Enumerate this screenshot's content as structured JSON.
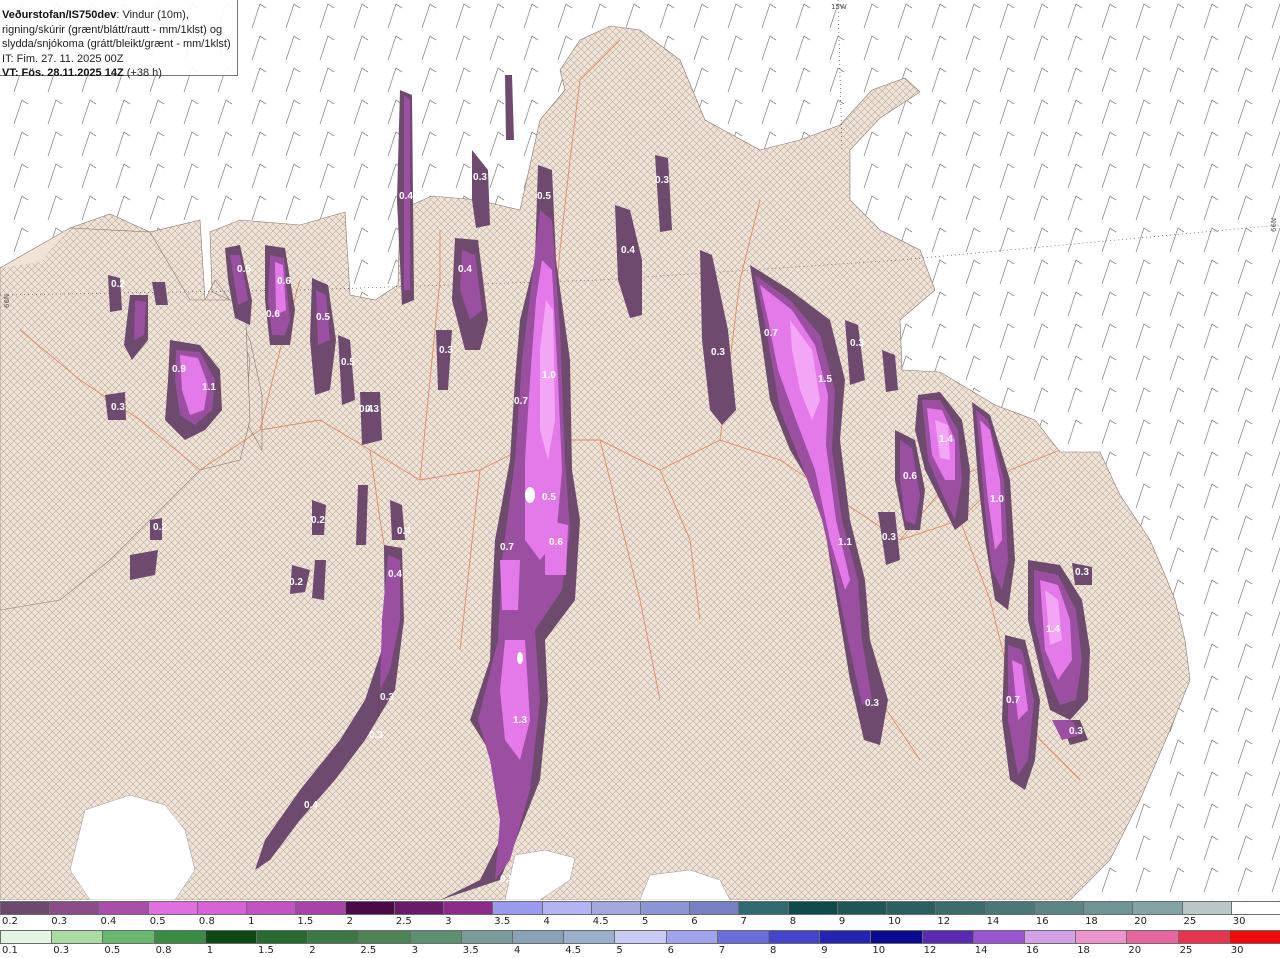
{
  "header": {
    "product": "Veðurstofan/IS750dev",
    "desc1": ": Vindur (10m),",
    "desc2": "rigning/skúrir (grænt/blátt/rautt - mm/1klst) og",
    "desc3": "slydda/snjókoma (grátt/bleikt/grænt - mm/1klst)",
    "it": "IT: Fim. 27. 11. 2025 00Z",
    "vt_bold": "VT: Fös. 28.11.2025 14Z",
    "vt_lead": " (+38 h)"
  },
  "coord_labels": {
    "top": "15W",
    "right": "66N",
    "left": "66N"
  },
  "precip_labels": [
    {
      "t": "0.4"
    },
    {
      "t": "0.4"
    },
    {
      "t": "0.3"
    },
    {
      "t": "0.3"
    },
    {
      "t": "0.5"
    },
    {
      "t": "0.6"
    },
    {
      "t": "0.6"
    },
    {
      "t": "0.5"
    },
    {
      "t": "0.5"
    },
    {
      "t": "0.4"
    },
    {
      "t": "0.3"
    },
    {
      "t": "1.0"
    },
    {
      "t": "0.7"
    },
    {
      "t": "0.5"
    },
    {
      "t": "0.7"
    },
    {
      "t": "0.6"
    },
    {
      "t": "0.9"
    },
    {
      "t": "1.1"
    },
    {
      "t": "0.3"
    },
    {
      "t": "0.2"
    },
    {
      "t": "0.2"
    },
    {
      "t": "0.4"
    },
    {
      "t": "0.2"
    },
    {
      "t": "0.2"
    },
    {
      "t": "0.4"
    },
    {
      "t": "0.3"
    },
    {
      "t": "0.3"
    },
    {
      "t": "0.4"
    },
    {
      "t": "1.3"
    },
    {
      "t": "0.5"
    },
    {
      "t": "0.7"
    },
    {
      "t": "1.5"
    },
    {
      "t": "0.3"
    },
    {
      "t": "0.4"
    },
    {
      "t": "1.4"
    },
    {
      "t": "0.6"
    },
    {
      "t": "1.0"
    },
    {
      "t": "1.1"
    },
    {
      "t": "0.3"
    },
    {
      "t": "0.3"
    },
    {
      "t": "0.3"
    },
    {
      "t": "1.4"
    },
    {
      "t": "0.7"
    },
    {
      "t": "0.3"
    },
    {
      "t": "0.3"
    },
    {
      "t": "0.3"
    },
    {
      "t": "0.5"
    }
  ],
  "legend_snow": [
    {
      "label": "0.2",
      "color": "#6b4a6e"
    },
    {
      "label": "0.3",
      "color": "#8a4d8a"
    },
    {
      "label": "0.4",
      "color": "#a94fa9"
    },
    {
      "label": "0.5",
      "color": "#e070e0"
    },
    {
      "label": "0.8",
      "color": "#d862d8"
    },
    {
      "label": "1",
      "color": "#c253c2"
    },
    {
      "label": "1.5",
      "color": "#a843a8"
    },
    {
      "label": "2",
      "color": "#4a0a4a"
    },
    {
      "label": "2.5",
      "color": "#6a1a6a"
    },
    {
      "label": "3",
      "color": "#8a2a8a"
    },
    {
      "label": "3.5",
      "color": "#9a9aee"
    },
    {
      "label": "4",
      "color": "#b4b4f4"
    },
    {
      "label": "4.5",
      "color": "#a3a9e0"
    },
    {
      "label": "5",
      "color": "#8c96d4"
    },
    {
      "label": "6",
      "color": "#7680c2"
    },
    {
      "label": "7",
      "color": "#2f6a6e"
    },
    {
      "label": "8",
      "color": "#0e4a4a"
    },
    {
      "label": "9",
      "color": "#1f5656"
    },
    {
      "label": "10",
      "color": "#2a6060"
    },
    {
      "label": "12",
      "color": "#3a6c6c"
    },
    {
      "label": "14",
      "color": "#4a7878"
    },
    {
      "label": "16",
      "color": "#5c8686"
    },
    {
      "label": "18",
      "color": "#6e9494"
    },
    {
      "label": "20",
      "color": "#84a4a4"
    },
    {
      "label": "25",
      "color": "#b8c8c8"
    },
    {
      "label": "30",
      "color": "#ffffff"
    }
  ],
  "legend_rain": [
    {
      "label": "0.1",
      "color": "#e2f6e2"
    },
    {
      "label": "0.3",
      "color": "#a8dca0"
    },
    {
      "label": "0.5",
      "color": "#6ab870"
    },
    {
      "label": "0.8",
      "color": "#3a8c44"
    },
    {
      "label": "1",
      "color": "#0f4a14"
    },
    {
      "label": "1.5",
      "color": "#286a30"
    },
    {
      "label": "2",
      "color": "#3c7844"
    },
    {
      "label": "2.5",
      "color": "#4c8456"
    },
    {
      "label": "3",
      "color": "#5c9070"
    },
    {
      "label": "3.5",
      "color": "#7a9c9a"
    },
    {
      "label": "4",
      "color": "#8aa2b8"
    },
    {
      "label": "4.5",
      "color": "#9ab0cc"
    },
    {
      "label": "5",
      "color": "#c8ccf4"
    },
    {
      "label": "6",
      "color": "#a0a4ec"
    },
    {
      "label": "7",
      "color": "#6a6edc"
    },
    {
      "label": "8",
      "color": "#4444cc"
    },
    {
      "label": "9",
      "color": "#2424b4"
    },
    {
      "label": "10",
      "color": "#0a0a90"
    },
    {
      "label": "12",
      "color": "#5a2ab4"
    },
    {
      "label": "14",
      "color": "#9a56d2"
    },
    {
      "label": "16",
      "color": "#d4a0e6"
    },
    {
      "label": "18",
      "color": "#ee94cc"
    },
    {
      "label": "20",
      "color": "#e8669e"
    },
    {
      "label": "25",
      "color": "#e8344e"
    },
    {
      "label": "30",
      "color": "#f00a0a"
    }
  ],
  "colors": {
    "land": "#f1e4d6",
    "sea": "#ffffff",
    "road": "#e67a52",
    "band_outer": "#6e4a6f",
    "band_mid": "#9b4fa0",
    "band_inner": "#e479ea",
    "band_core": "#f3a6f6"
  }
}
